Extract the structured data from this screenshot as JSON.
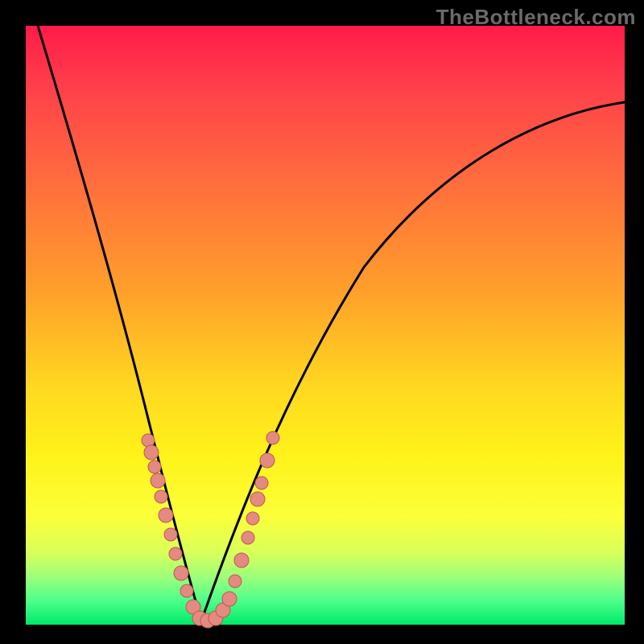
{
  "watermark": "TheBottleneck.com",
  "colors": {
    "frame": "#000000",
    "gradient_top": "#ff1a4a",
    "gradient_bottom": "#00e96a",
    "curve": "#000000",
    "dot_fill": "#e48a80",
    "dot_stroke": "#b85c50"
  },
  "chart_data": {
    "type": "line",
    "title": "",
    "xlabel": "",
    "ylabel": "",
    "xlim": [
      0,
      100
    ],
    "ylim": [
      0,
      100
    ],
    "grid": false,
    "note": "Background heat gradient red→green (top→bottom). Two branches forming a V/check shape; values are approximate percentages of plot area.",
    "series": [
      {
        "name": "left-branch",
        "x": [
          2,
          6,
          10,
          14,
          18,
          20,
          22,
          24,
          26,
          28,
          29
        ],
        "y": [
          100,
          81,
          62,
          47,
          33,
          26,
          20,
          14,
          8,
          2,
          0
        ]
      },
      {
        "name": "right-branch",
        "x": [
          29,
          31,
          34,
          38,
          42,
          48,
          56,
          66,
          78,
          90,
          100
        ],
        "y": [
          0,
          2,
          8,
          18,
          30,
          44,
          58,
          69,
          78,
          84,
          88
        ]
      }
    ],
    "dots_left_branch": [
      {
        "x": 20,
        "y": 30
      },
      {
        "x": 20.5,
        "y": 28
      },
      {
        "x": 21,
        "y": 25
      },
      {
        "x": 21.5,
        "y": 23
      },
      {
        "x": 22,
        "y": 20
      },
      {
        "x": 23,
        "y": 17
      },
      {
        "x": 24,
        "y": 13
      },
      {
        "x": 25,
        "y": 10
      },
      {
        "x": 26,
        "y": 7
      },
      {
        "x": 27,
        "y": 4
      }
    ],
    "dots_bottom": [
      {
        "x": 28,
        "y": 1
      },
      {
        "x": 29,
        "y": 0.3
      },
      {
        "x": 30,
        "y": 0.3
      },
      {
        "x": 31,
        "y": 0.6
      },
      {
        "x": 32,
        "y": 1.4
      },
      {
        "x": 33,
        "y": 2.5
      }
    ],
    "dots_right_branch": [
      {
        "x": 34,
        "y": 7
      },
      {
        "x": 35,
        "y": 11
      },
      {
        "x": 36,
        "y": 15
      },
      {
        "x": 37,
        "y": 19
      },
      {
        "x": 38,
        "y": 23
      },
      {
        "x": 38.5,
        "y": 25
      },
      {
        "x": 39.5,
        "y": 29
      },
      {
        "x": 40.5,
        "y": 33
      }
    ]
  }
}
